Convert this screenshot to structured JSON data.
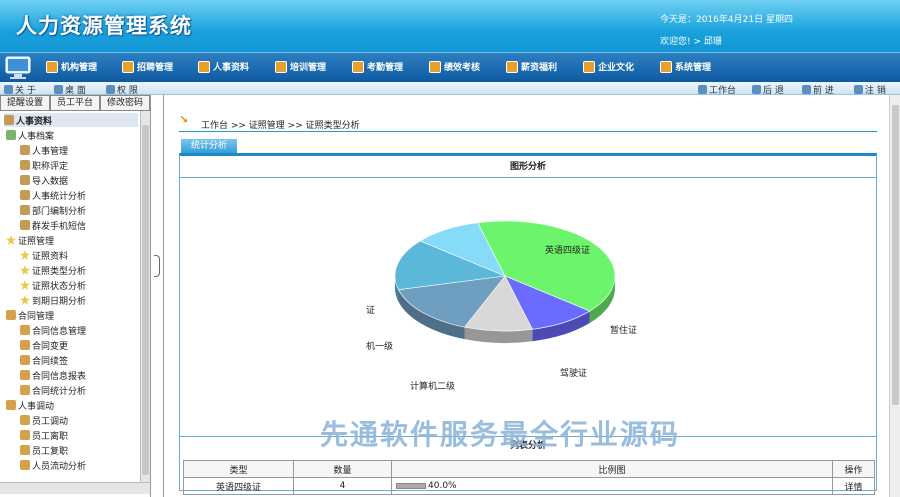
{
  "header": {
    "title": "人力资源管理系统",
    "date_label": "今天是：2016年4月21日  星期四",
    "welcome": "欢迎您!  > 邱珊"
  },
  "menu": [
    "机构管理",
    "招聘管理",
    "人事资料",
    "培训管理",
    "考勤管理",
    "绩效考核",
    "薪资福利",
    "企业文化",
    "系统管理"
  ],
  "toolbar": {
    "left": [
      "关 于",
      "桌 面",
      "权 限"
    ],
    "right": [
      "工作台",
      "后 退",
      "前 进",
      "注 销"
    ]
  },
  "sidebar": {
    "tabs": [
      "提醒设置",
      "员工平台",
      "修改密码"
    ],
    "root": "人事资料",
    "tree": [
      {
        "label": "人事档案",
        "level": 1
      },
      {
        "label": "人事管理",
        "level": 3
      },
      {
        "label": "职称评定",
        "level": 3
      },
      {
        "label": "导入数据",
        "level": 3
      },
      {
        "label": "人事统计分析",
        "level": 3
      },
      {
        "label": "部门编制分析",
        "level": 3
      },
      {
        "label": "群发手机短信",
        "level": 3
      },
      {
        "label": "证照管理",
        "level": 2
      },
      {
        "label": "证照资料",
        "level": 2
      },
      {
        "label": "证照类型分析",
        "level": 2
      },
      {
        "label": "证照状态分析",
        "level": 2
      },
      {
        "label": "到期日期分析",
        "level": 2
      },
      {
        "label": "合同管理",
        "level": 0
      },
      {
        "label": "合同信息管理",
        "level": 0
      },
      {
        "label": "合同变更",
        "level": 0
      },
      {
        "label": "合同续签",
        "level": 0
      },
      {
        "label": "合同信息报表",
        "level": 0
      },
      {
        "label": "合同统计分析",
        "level": 0
      },
      {
        "label": "人事调动",
        "level": 0
      },
      {
        "label": "员工调动",
        "level": 0
      },
      {
        "label": "员工离职",
        "level": 0
      },
      {
        "label": "员工复职",
        "level": 0
      },
      {
        "label": "人员流动分析",
        "level": 0
      }
    ]
  },
  "main": {
    "breadcrumb": "工作台 >> 证照管理 >> 证照类型分析",
    "tab": "统计分析",
    "panel_title": "图形分析",
    "list_title": "列表分析",
    "table": {
      "headers": [
        "类型",
        "数量",
        "比例图",
        "操作"
      ],
      "rows": [
        {
          "type": "英语四级证",
          "count": "4",
          "ratio": "40.0%",
          "action": "详情"
        }
      ]
    }
  },
  "chart_data": {
    "type": "pie",
    "categories": [
      "英语四级证",
      "暂住证",
      "驾驶证",
      "计算机二级",
      "机一级",
      "证"
    ],
    "values": [
      40,
      10,
      10,
      15,
      15,
      10
    ],
    "colors": [
      "#6cf46c",
      "#6b6bff",
      "#d8d8d8",
      "#6f9fc0",
      "#5bb8d8",
      "#86dcf8"
    ]
  },
  "watermark": "先通软件服务最全行业源码"
}
